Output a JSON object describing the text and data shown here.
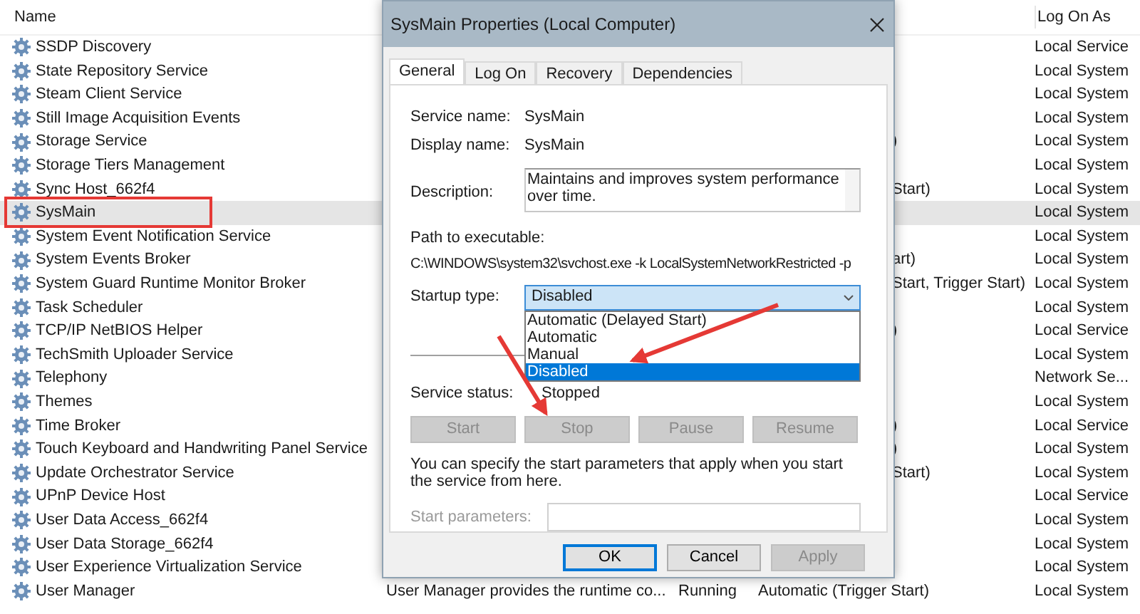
{
  "services": {
    "columns": [
      {
        "label": "Name"
      },
      {
        "label": "Log On As"
      }
    ],
    "rows": [
      {
        "name": "SSDP Discovery",
        "log_on_as": "Local Service",
        "selected": false
      },
      {
        "name": "State Repository Service",
        "log_on_as": "Local System",
        "selected": false
      },
      {
        "name": "Steam Client Service",
        "log_on_as": "Local System",
        "selected": false
      },
      {
        "name": "Still Image Acquisition Events",
        "log_on_as": "Local System",
        "selected": false
      },
      {
        "name": "Storage Service",
        "startup_fragment": ")",
        "log_on_as": "Local System",
        "selected": false
      },
      {
        "name": "Storage Tiers Management",
        "log_on_as": "Local System",
        "selected": false
      },
      {
        "name": "Sync Host_662f4",
        "startup_fragment": "Start)",
        "log_on_as": "Local System",
        "selected": false
      },
      {
        "name": "SysMain",
        "log_on_as": "Local System",
        "selected": true,
        "boxed": true
      },
      {
        "name": "System Event Notification Service",
        "log_on_as": "Local System",
        "selected": false
      },
      {
        "name": "System Events Broker",
        "startup_fragment": "art)",
        "log_on_as": "Local System",
        "selected": false
      },
      {
        "name": "System Guard Runtime Monitor Broker",
        "startup_fragment": "Start, Trigger Start)",
        "log_on_as": "Local System",
        "selected": false
      },
      {
        "name": "Task Scheduler",
        "log_on_as": "Local System",
        "selected": false
      },
      {
        "name": "TCP/IP NetBIOS Helper",
        "startup_fragment": ")",
        "log_on_as": "Local Service",
        "selected": false
      },
      {
        "name": "TechSmith Uploader Service",
        "log_on_as": "Local System",
        "selected": false
      },
      {
        "name": "Telephony",
        "log_on_as": "Network Se...",
        "selected": false
      },
      {
        "name": "Themes",
        "log_on_as": "Local System",
        "selected": false
      },
      {
        "name": "Time Broker",
        "startup_fragment": ")",
        "log_on_as": "Local Service",
        "selected": false
      },
      {
        "name": "Touch Keyboard and Handwriting Panel Service",
        "startup_fragment": ")",
        "log_on_as": "Local System",
        "selected": false
      },
      {
        "name": "Update Orchestrator Service",
        "startup_fragment": "Start)",
        "log_on_as": "Local System",
        "selected": false
      },
      {
        "name": "UPnP Device Host",
        "log_on_as": "Local Service",
        "selected": false
      },
      {
        "name": "User Data Access_662f4",
        "log_on_as": "Local System",
        "selected": false
      },
      {
        "name": "User Data Storage_662f4",
        "log_on_as": "Local System",
        "selected": false
      },
      {
        "name": "User Experience Virtualization Service",
        "log_on_as": "Local System",
        "selected": false
      },
      {
        "name": "User Manager",
        "description": "User Manager provides the runtime co...",
        "status": "Running",
        "startup_type": "Automatic (Trigger Start)",
        "log_on_as": "Local System",
        "selected": false
      }
    ]
  },
  "dialog": {
    "title": "SysMain Properties (Local Computer)",
    "tabs": [
      {
        "label": "General",
        "selected": true
      },
      {
        "label": "Log On",
        "selected": false
      },
      {
        "label": "Recovery",
        "selected": false
      },
      {
        "label": "Dependencies",
        "selected": false
      }
    ],
    "service_name": {
      "label": "Service name:",
      "value": "SysMain"
    },
    "display_name": {
      "label": "Display name:",
      "value": "SysMain"
    },
    "description": {
      "label": "Description:",
      "value": "Maintains and improves system performance over time."
    },
    "path": {
      "label": "Path to executable:",
      "value": "C:\\WINDOWS\\system32\\svchost.exe -k LocalSystemNetworkRestricted -p"
    },
    "startup_type": {
      "label": "Startup type:",
      "value": "Disabled",
      "expanded": true,
      "options": [
        {
          "label": "Automatic (Delayed Start)",
          "selected": false
        },
        {
          "label": "Automatic",
          "selected": false
        },
        {
          "label": "Manual",
          "selected": false
        },
        {
          "label": "Disabled",
          "selected": true
        }
      ]
    },
    "service_status": {
      "label": "Service status:",
      "value": "Stopped"
    },
    "control_buttons": [
      {
        "label": "Start",
        "disabled": true
      },
      {
        "label": "Stop",
        "disabled": true
      },
      {
        "label": "Pause",
        "disabled": true
      },
      {
        "label": "Resume",
        "disabled": true
      }
    ],
    "hint": "You can specify the start parameters that apply when you start the service from here.",
    "start_parameters": {
      "label": "Start parameters:",
      "disabled": true
    },
    "footer_buttons": [
      {
        "label": "OK",
        "disabled": false,
        "default": true
      },
      {
        "label": "Cancel",
        "disabled": false,
        "default": false
      },
      {
        "label": "Apply",
        "disabled": true,
        "default": false
      }
    ]
  }
}
